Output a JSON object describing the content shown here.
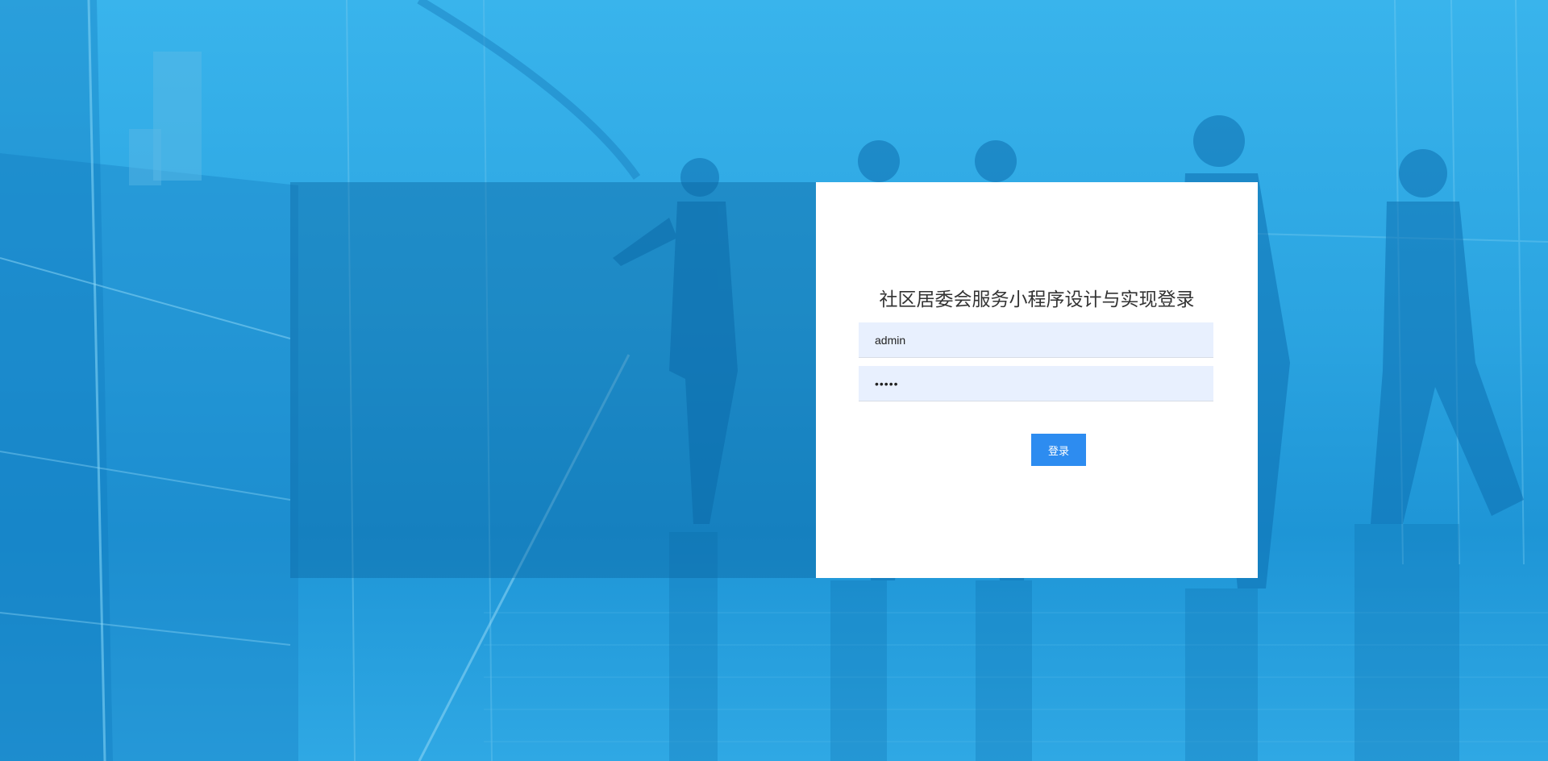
{
  "login": {
    "title": "社区居委会服务小程序设计与实现登录",
    "username_value": "admin",
    "password_value": "•••••",
    "submit_label": "登录"
  },
  "theme": {
    "background": "#2aa3e0",
    "panel_overlay": "#0a64a0",
    "card": "#ffffff",
    "input_bg": "#e8f0fe",
    "button": "#2d8cf0"
  }
}
